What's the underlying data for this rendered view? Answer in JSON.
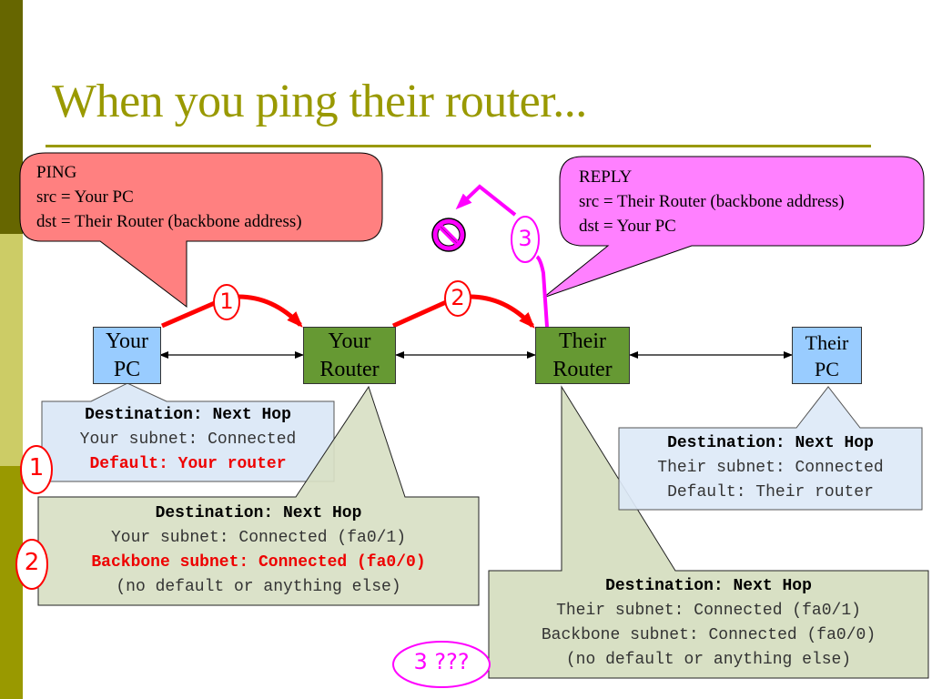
{
  "slide": {
    "title": "When you ping their router..."
  },
  "colors": {
    "sidebar_dark": "#666600",
    "sidebar_light": "#cccc66",
    "sidebar_mid": "#999900",
    "title": "#999900",
    "ping_callout": "#ff8080",
    "reply_callout": "#ff80ff",
    "pc_node": "#99ccff",
    "router_node": "#669933",
    "pc_table": "#dde9f7",
    "router_table": "#d8e0c4",
    "ping_path": "#ff0000",
    "reply_path": "#ff00ff"
  },
  "callouts": {
    "ping": {
      "lines": [
        "PING",
        "src = Your PC",
        "dst = Their Router (backbone address)"
      ]
    },
    "reply": {
      "lines": [
        "REPLY",
        "src = Their Router (backbone address)",
        "dst = Your PC"
      ]
    }
  },
  "nodes": {
    "your_pc": {
      "line1": "Your",
      "line2": "PC"
    },
    "your_router": {
      "line1": "Your",
      "line2": "Router"
    },
    "their_router": {
      "line1": "Their",
      "line2": "Router"
    },
    "their_pc": {
      "line1": "Their",
      "line2": "PC"
    }
  },
  "steps": {
    "step1": "1",
    "step2": "2",
    "step3": "3",
    "step3_question": "3 ???",
    "blocked_icon": "no-entry-icon"
  },
  "tables": {
    "your_pc": {
      "header": "Destination: Next Hop",
      "rows": [
        "Your subnet: Connected",
        "Default: Your router"
      ],
      "highlighted_row": 1,
      "step_marker": "1"
    },
    "your_router": {
      "header": "Destination: Next Hop",
      "rows": [
        "Your subnet: Connected (fa0/1)",
        "Backbone subnet: Connected (fa0/0)",
        "(no default or anything else)"
      ],
      "highlighted_row": 1,
      "step_marker": "2"
    },
    "their_pc": {
      "header": "Destination: Next Hop",
      "rows": [
        "Their subnet: Connected",
        "Default: Their router"
      ]
    },
    "their_router": {
      "header": "Destination: Next Hop",
      "rows": [
        "Their subnet: Connected (fa0/1)",
        "Backbone subnet: Connected (fa0/0)",
        "(no default or anything else)"
      ]
    }
  }
}
